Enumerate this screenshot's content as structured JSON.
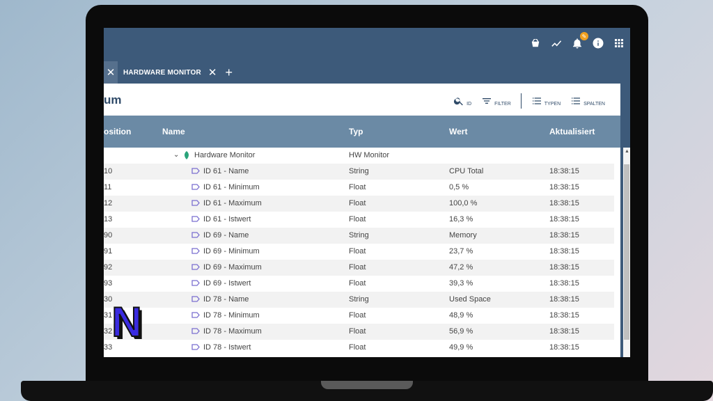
{
  "tabs": {
    "prev_close": "✕",
    "active_label": "HARDWARE MONITOR",
    "active_close": "✕",
    "add": "+"
  },
  "topbar": {
    "icons": [
      "basket-icon",
      "chart-icon",
      "bell-icon",
      "info-icon",
      "apps-grid-icon"
    ],
    "bell_badge": "✎"
  },
  "titlebar": {
    "title": "um",
    "tools": {
      "search_label": "ID",
      "filter_label": "FILTER",
      "types_label": "TYPEN",
      "columns_label": "SPALTEN"
    }
  },
  "table": {
    "columns": [
      "osition",
      "Name",
      "Typ",
      "Wert",
      "Aktualisiert"
    ],
    "group_row": {
      "name": "Hardware Monitor",
      "type": "HW Monitor"
    },
    "rows": [
      {
        "position": "10",
        "name": "ID 61 - Name",
        "type": "String",
        "value": "CPU Total",
        "updated": "18:38:15"
      },
      {
        "position": "11",
        "name": "ID 61 - Minimum",
        "type": "Float",
        "value": "0,5 %",
        "updated": "18:38:15"
      },
      {
        "position": "12",
        "name": "ID 61 - Maximum",
        "type": "Float",
        "value": "100,0 %",
        "updated": "18:38:15"
      },
      {
        "position": "13",
        "name": "ID 61 - Istwert",
        "type": "Float",
        "value": "16,3 %",
        "updated": "18:38:15"
      },
      {
        "position": "90",
        "name": "ID 69 - Name",
        "type": "String",
        "value": "Memory",
        "updated": "18:38:15"
      },
      {
        "position": "91",
        "name": "ID 69 - Minimum",
        "type": "Float",
        "value": "23,7 %",
        "updated": "18:38:15"
      },
      {
        "position": "92",
        "name": "ID 69 - Maximum",
        "type": "Float",
        "value": "47,2 %",
        "updated": "18:38:15"
      },
      {
        "position": "93",
        "name": "ID 69 - Istwert",
        "type": "Float",
        "value": "39,3 %",
        "updated": "18:38:15"
      },
      {
        "position": "30",
        "name": "ID 78 - Name",
        "type": "String",
        "value": "Used Space",
        "updated": "18:38:15"
      },
      {
        "position": "31",
        "name": "ID 78 - Minimum",
        "type": "Float",
        "value": "48,9 %",
        "updated": "18:38:15"
      },
      {
        "position": "32",
        "name": "ID 78 - Maximum",
        "type": "Float",
        "value": "56,9 %",
        "updated": "18:38:15"
      },
      {
        "position": "33",
        "name": "ID 78 - Istwert",
        "type": "Float",
        "value": "49,9 %",
        "updated": "18:38:15"
      }
    ]
  },
  "colors": {
    "topbar": "#3d5a7a",
    "table_header": "#6b8aa5",
    "accent_text": "#2f4a68",
    "tag_icon": "#7b6fd0",
    "leaf_icon": "#2aa37a",
    "badge": "#f0a020"
  },
  "overlay_logo": {
    "letter": "N"
  }
}
